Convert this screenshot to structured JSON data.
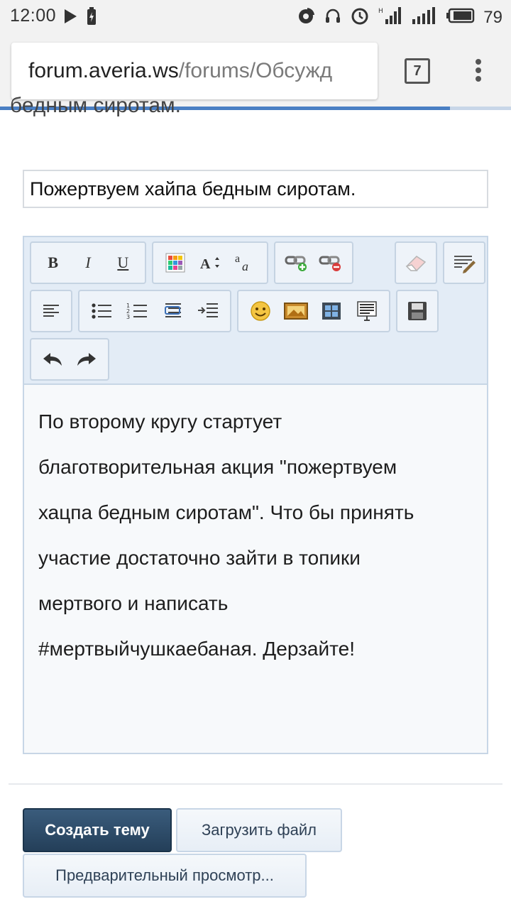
{
  "status_bar": {
    "time": "12:00",
    "battery_level": "79",
    "icons": [
      "play-icon",
      "battery-saver-icon",
      "pie-icon",
      "headset-icon",
      "alarm-icon",
      "signal-h-icon",
      "signal-icon",
      "battery-icon"
    ]
  },
  "browser": {
    "url_host": "forum.averia.ws",
    "url_path": "/forums/Обсужд",
    "tab_count": "7",
    "load_progress": 0.88
  },
  "page": {
    "cut_heading": "бедным сиротам.",
    "title_value": "Пожертвуем хайпа бедным сиротам.",
    "editor": {
      "toolbar_icons": [
        "bold",
        "italic",
        "underline",
        "text-color",
        "font-size",
        "font-family",
        "link",
        "unlink",
        "remove-format",
        "source-mode",
        "align-left",
        "unordered-list",
        "ordered-list",
        "outdent",
        "indent",
        "smilies",
        "image",
        "media",
        "code",
        "save-draft",
        "undo",
        "redo"
      ],
      "toolbar_labels": {
        "bold": "B",
        "italic": "I",
        "underline": "U"
      },
      "body_lines": [
        "По второму кругу стартует",
        "благотворительная акция \"пожертвуем",
        "хацпа бедным сиротам\". Что бы принять",
        "участие достаточно зайти в топики",
        "мертвого и написать",
        "#мертвыйчушкаебаная. Дерзайте!"
      ]
    },
    "buttons": {
      "create_topic": "Создать тему",
      "upload_file": "Загрузить файл",
      "preview": "Предварительный просмотр..."
    }
  }
}
